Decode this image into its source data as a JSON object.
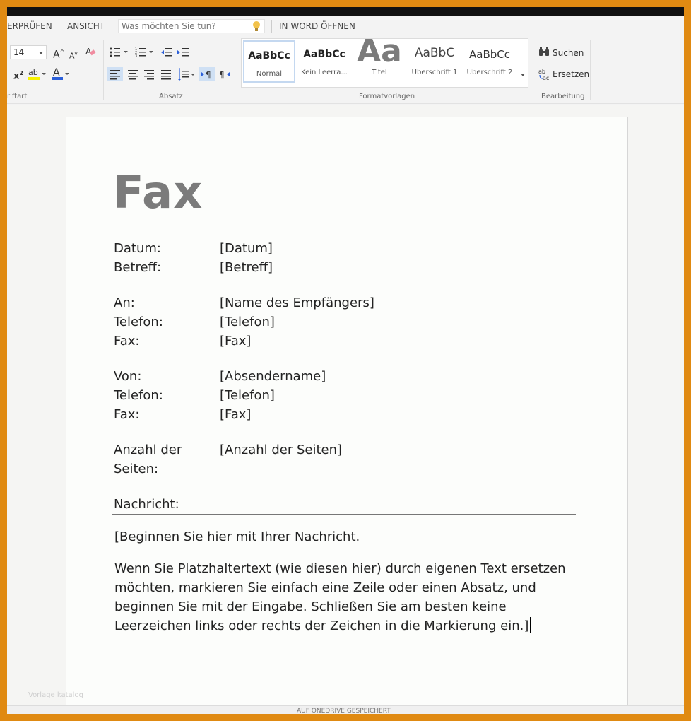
{
  "tabs": [
    {
      "label": "ERPRÜFEN"
    },
    {
      "label": "ANSICHT"
    }
  ],
  "tell_me": {
    "placeholder": "Was möchten Sie tun?"
  },
  "open_in_word": "IN WORD ÖFFNEN",
  "ribbon": {
    "font_group": {
      "label": "riftart",
      "font_size": "14"
    },
    "paragraph_group": {
      "label": "Absatz"
    },
    "styles_group": {
      "label": "Formatvorlagen",
      "styles": [
        {
          "sample": "AaBbCc",
          "name": "Normal"
        },
        {
          "sample": "AaBbCc",
          "name": "Kein Leerra..."
        },
        {
          "sample": "Aa",
          "name": "Titel"
        },
        {
          "sample": "AaBbC",
          "name": "Überschrift 1"
        },
        {
          "sample": "AaBbCc",
          "name": "Überschrift 2"
        }
      ]
    },
    "editing_group": {
      "label": "Bearbeitung",
      "find": "Suchen",
      "replace": "Ersetzen"
    }
  },
  "document": {
    "title": "Fax",
    "fields": [
      {
        "label": "Datum:",
        "value": "[Datum]"
      },
      {
        "label": "Betreff:",
        "value": "[Betreff]"
      },
      {
        "label": "An:",
        "value": "[Name des Empfängers]"
      },
      {
        "label": "Telefon:",
        "value": "[Telefon]"
      },
      {
        "label": "Fax:",
        "value": "[Fax]"
      },
      {
        "label": "Von:",
        "value": "[Absendername]"
      },
      {
        "label": "Telefon:",
        "value": "[Telefon]"
      },
      {
        "label": "Fax:",
        "value": "[Fax]"
      },
      {
        "label": "Anzahl der Seiten:",
        "label_line1": "Anzahl der",
        "label_line2": "Seiten:",
        "value": "[Anzahl der Seiten]"
      }
    ],
    "message_label": "Nachricht:",
    "message_paragraphs": [
      "[Beginnen Sie hier mit Ihrer Nachricht.",
      "Wenn Sie Platzhaltertext (wie diesen hier) durch eigenen Text ersetzen möchten, markieren Sie einfach eine Zeile oder einen Absatz, und beginnen Sie mit der Eingabe. Schließen Sie am besten keine Leerzeichen links oder rechts der Zeichen in die Markierung ein.]"
    ]
  },
  "watermark": "Vorlage katalog",
  "status_text": "AUF ONEDRIVE GESPEICHERT",
  "colors": {
    "frame_border": "#e08a12",
    "title_gray": "#7b7b7b",
    "selection": "#cfe0f4"
  }
}
